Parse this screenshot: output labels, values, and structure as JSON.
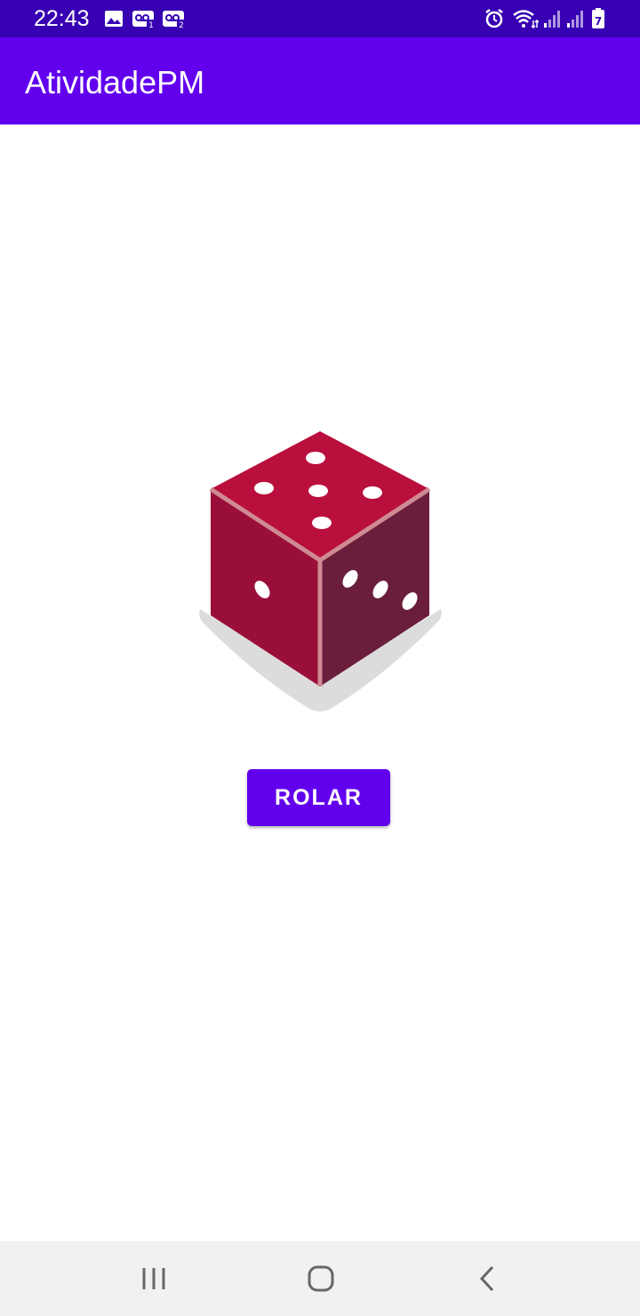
{
  "status_bar": {
    "time": "22:43",
    "left_icons": [
      "image-icon",
      "voicemail-1-icon",
      "voicemail-2-icon"
    ],
    "right_icons": [
      "alarm-icon",
      "wifi-icon",
      "signal-icon",
      "signal-icon",
      "battery-icon"
    ],
    "color": "#3700b3"
  },
  "app_bar": {
    "title": "AtividadePM",
    "color": "#6200ee"
  },
  "dice": {
    "top_face_pips": 5,
    "left_face_pips": 1,
    "right_face_pips": 3,
    "colors": {
      "top": "#b90f3c",
      "left": "#9a0f3a",
      "right": "#6a1e3c",
      "edge": "#cf8a93",
      "shadow": "#dcdcdc"
    }
  },
  "roll_button": {
    "label": "ROLAR",
    "color": "#6200ee"
  },
  "nav_bar": {
    "buttons": [
      "recents-icon",
      "home-icon",
      "back-icon"
    ]
  }
}
